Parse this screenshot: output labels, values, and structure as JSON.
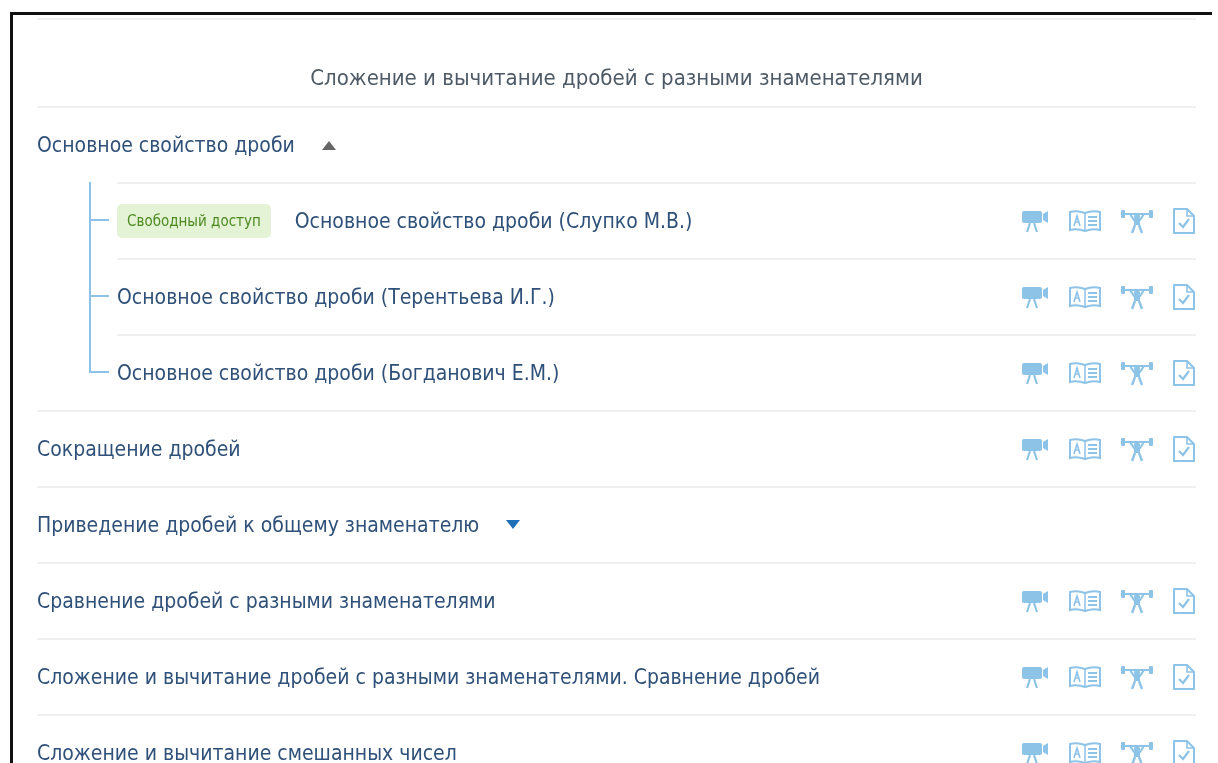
{
  "heading": "Сложение и вычитание дробей с разными знаменателями",
  "topics": [
    {
      "kind": "group",
      "title": "Основное свойство дроби",
      "expanded": true,
      "children": [
        {
          "title": "Основное свойство дроби (Слупко М.В.)",
          "badge": "Свободный доступ"
        },
        {
          "title": "Основное свойство дроби (Терентьева И.Г.)"
        },
        {
          "title": "Основное свойство дроби (Богданович Е.М.)"
        }
      ]
    },
    {
      "kind": "lesson",
      "title": "Сокращение дробей"
    },
    {
      "kind": "group",
      "title": "Приведение дробей к общему знаменателю",
      "expanded": false
    },
    {
      "kind": "lesson",
      "title": "Сравнение дробей с разными знаменателями"
    },
    {
      "kind": "lesson",
      "title": "Сложение и вычитание дробей с разными знаменателями. Сравнение дробей"
    },
    {
      "kind": "lesson",
      "title": "Сложение и вычитание смешанных чисел"
    }
  ]
}
